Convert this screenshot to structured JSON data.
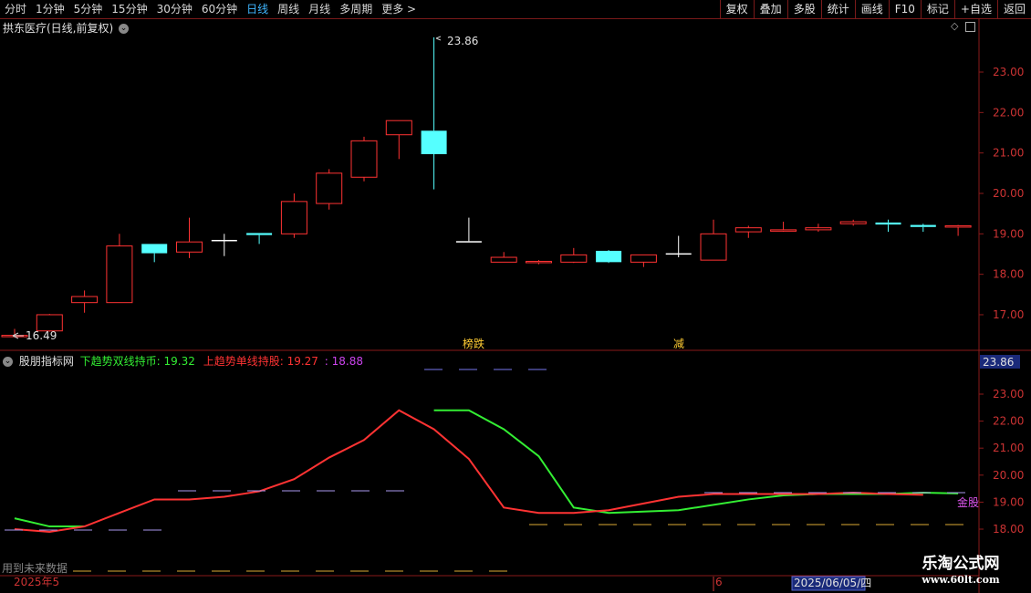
{
  "toolbar": {
    "periods": [
      "分时",
      "1分钟",
      "5分钟",
      "15分钟",
      "30分钟",
      "60分钟",
      "日线",
      "周线",
      "月线",
      "多周期",
      "更多 >"
    ],
    "active_period": "日线",
    "buttons": [
      "复权",
      "叠加",
      "多股",
      "统计",
      "画线",
      "F10",
      "标记",
      "+自选",
      "返回"
    ]
  },
  "main_chart": {
    "title": "拱东医疗(日线,前复权)",
    "high_label": "23.86",
    "low_label": "16.49",
    "markers": [
      "榜跌",
      "减"
    ],
    "y_ticks": [
      "23.00",
      "22.00",
      "21.00",
      "20.00",
      "19.00",
      "18.00",
      "17.00"
    ],
    "candles": [
      {
        "open": 16.49,
        "close": 16.49,
        "high": 16.65,
        "low": 16.45,
        "color": "red"
      },
      {
        "open": 16.6,
        "close": 17.0,
        "high": 17.02,
        "low": 16.58,
        "color": "red"
      },
      {
        "open": 17.3,
        "close": 17.45,
        "high": 17.6,
        "low": 17.05,
        "color": "red"
      },
      {
        "open": 17.3,
        "close": 18.7,
        "high": 19.0,
        "low": 17.3,
        "color": "red"
      },
      {
        "open": 18.75,
        "close": 18.52,
        "high": 18.75,
        "low": 18.3,
        "color": "cyan"
      },
      {
        "open": 18.55,
        "close": 18.8,
        "high": 19.4,
        "low": 18.4,
        "color": "red"
      },
      {
        "open": 18.85,
        "close": 18.85,
        "high": 19.0,
        "low": 18.45,
        "color": "white"
      },
      {
        "open": 19.02,
        "close": 18.97,
        "high": 19.02,
        "low": 18.75,
        "color": "cyan"
      },
      {
        "open": 19.0,
        "close": 19.8,
        "high": 20.0,
        "low": 18.9,
        "color": "red"
      },
      {
        "open": 19.75,
        "close": 20.5,
        "high": 20.6,
        "low": 19.6,
        "color": "red"
      },
      {
        "open": 20.4,
        "close": 21.3,
        "high": 21.4,
        "low": 20.3,
        "color": "red"
      },
      {
        "open": 21.45,
        "close": 21.8,
        "high": 21.8,
        "low": 20.85,
        "color": "red"
      },
      {
        "open": 21.55,
        "close": 20.97,
        "high": 23.86,
        "low": 20.1,
        "color": "cyan"
      },
      {
        "open": 18.82,
        "close": 18.82,
        "high": 19.4,
        "low": 18.82,
        "color": "white"
      },
      {
        "open": 18.3,
        "close": 18.42,
        "high": 18.55,
        "low": 18.3,
        "color": "red"
      },
      {
        "open": 18.3,
        "close": 18.32,
        "high": 18.35,
        "low": 18.25,
        "color": "red"
      },
      {
        "open": 18.3,
        "close": 18.48,
        "high": 18.65,
        "low": 18.28,
        "color": "red"
      },
      {
        "open": 18.58,
        "close": 18.3,
        "high": 18.6,
        "low": 18.28,
        "color": "cyan"
      },
      {
        "open": 18.3,
        "close": 18.48,
        "high": 18.48,
        "low": 18.18,
        "color": "red"
      },
      {
        "open": 18.52,
        "close": 18.52,
        "high": 18.95,
        "low": 18.42,
        "color": "white"
      },
      {
        "open": 18.35,
        "close": 19.0,
        "high": 19.35,
        "low": 18.35,
        "color": "red"
      },
      {
        "open": 19.05,
        "close": 19.15,
        "high": 19.2,
        "low": 18.9,
        "color": "red"
      },
      {
        "open": 19.1,
        "close": 19.08,
        "high": 19.3,
        "low": 19.05,
        "color": "red"
      },
      {
        "open": 19.1,
        "close": 19.15,
        "high": 19.25,
        "low": 19.05,
        "color": "red"
      },
      {
        "open": 19.25,
        "close": 19.3,
        "high": 19.35,
        "low": 19.2,
        "color": "red"
      },
      {
        "open": 19.28,
        "close": 19.23,
        "high": 19.35,
        "low": 19.05,
        "color": "cyan"
      },
      {
        "open": 19.22,
        "close": 19.17,
        "high": 19.25,
        "low": 19.05,
        "color": "cyan"
      },
      {
        "open": 19.18,
        "close": 19.2,
        "high": 19.22,
        "low": 18.95,
        "color": "red"
      }
    ]
  },
  "indicator": {
    "title": "股朋指标网",
    "legend": [
      {
        "text": "下趋势双线持币: 19.32",
        "color": "#33ee33"
      },
      {
        "text": "上趋势单线持股: 19.27",
        "color": "#ff3333"
      },
      {
        "text": ": 18.88",
        "color": "#cc44ee"
      }
    ],
    "price_box": "23.86",
    "y_ticks": [
      "23.00",
      "22.00",
      "21.00",
      "20.00",
      "19.00",
      "18.00"
    ],
    "gold_label": "金股",
    "future_data_note": "用到未来数据",
    "green_line": [
      18.4,
      18.1,
      18.1,
      null,
      null,
      null,
      null,
      null,
      null,
      null,
      null,
      null,
      22.4,
      22.4,
      21.7,
      20.7,
      18.8,
      18.6,
      18.65,
      18.7,
      18.9,
      19.1,
      19.25,
      19.3,
      19.3,
      19.3,
      19.35,
      19.32
    ],
    "red_line": [
      18.0,
      17.9,
      18.1,
      18.6,
      19.1,
      19.1,
      19.2,
      19.4,
      19.85,
      20.65,
      21.3,
      22.4,
      21.7,
      20.6,
      18.8,
      18.6,
      18.6,
      18.7,
      18.95,
      19.2,
      19.3,
      19.3,
      19.3,
      19.3,
      19.35,
      19.3,
      19.27
    ]
  },
  "date_axis": {
    "labels": [
      "2025年5",
      "6",
      "2025/06/05/四"
    ]
  },
  "watermark": {
    "line1": "乐淘公式网",
    "line2": "www.60lt.com"
  },
  "colors": {
    "up": "#ff3333",
    "down": "#55ffff",
    "flat": "#ffffff",
    "axis": "#8a1a1a",
    "tick_text": "#cc3333",
    "legend_green": "#33ee33",
    "legend_red": "#ff3333",
    "legend_purple": "#cc44ee"
  }
}
